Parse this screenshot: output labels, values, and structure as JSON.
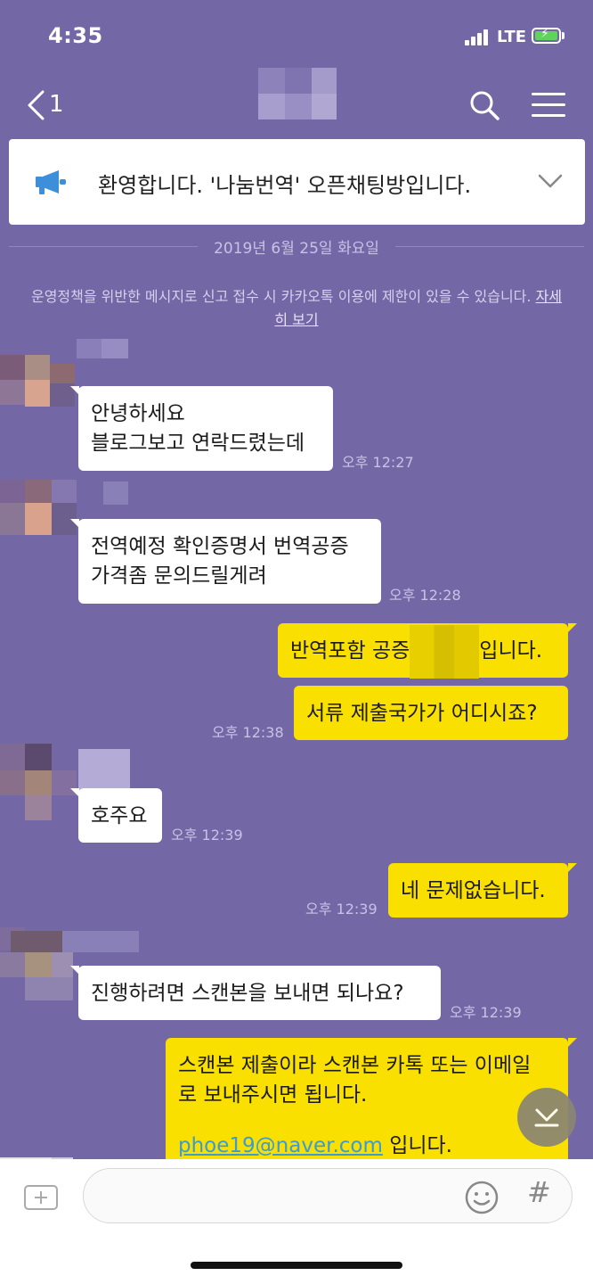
{
  "status_bar": {
    "time": "4:35",
    "network": "LTE"
  },
  "header": {
    "unread_count": "1"
  },
  "notice": {
    "text": "환영합니다. '나눔번역' 오픈채팅방입니다."
  },
  "date_divider": "2019년 6월 25일 화요일",
  "policy": {
    "text": "운영정책을 위반한 메시지로 신고 접수 시 카카오톡 이용에 제한이 있을 수 있습니다.",
    "link": "자세히 보기"
  },
  "messages": [
    {
      "side": "in",
      "lines": [
        "안녕하세요",
        "블로그보고 연락드렸는데"
      ],
      "time": "오후 12:27"
    },
    {
      "side": "in",
      "lines": [
        "전역예정 확인증명서 번역공증",
        "가격좀 문의드릴게려"
      ],
      "time": "오후 12:28"
    },
    {
      "side": "out",
      "prefix": "반역포함 공증",
      "suffix": "입니다."
    },
    {
      "side": "out",
      "lines": [
        "서류 제출국가가 어디시죠?"
      ],
      "time": "오후 12:38"
    },
    {
      "side": "in",
      "lines": [
        "호주요"
      ],
      "time": "오후 12:39"
    },
    {
      "side": "out",
      "lines": [
        "네 문제없습니다."
      ],
      "time": "오후 12:39"
    },
    {
      "side": "in",
      "lines": [
        "진행하려면 스캔본을 보내면 되나요?"
      ],
      "time": "오후 12:39"
    },
    {
      "side": "out",
      "lines": [
        "스캔본 제출이라 스캔본 카톡 또는 이메일",
        "로 보내주시면 됩니다."
      ],
      "email": "phoe19@naver.com",
      "email_suffix": " 입니다."
    }
  ],
  "input": {
    "placeholder": ""
  },
  "colors": {
    "background": "#7467a6",
    "outgoing_bubble": "#f9e000",
    "incoming_bubble": "#ffffff"
  }
}
